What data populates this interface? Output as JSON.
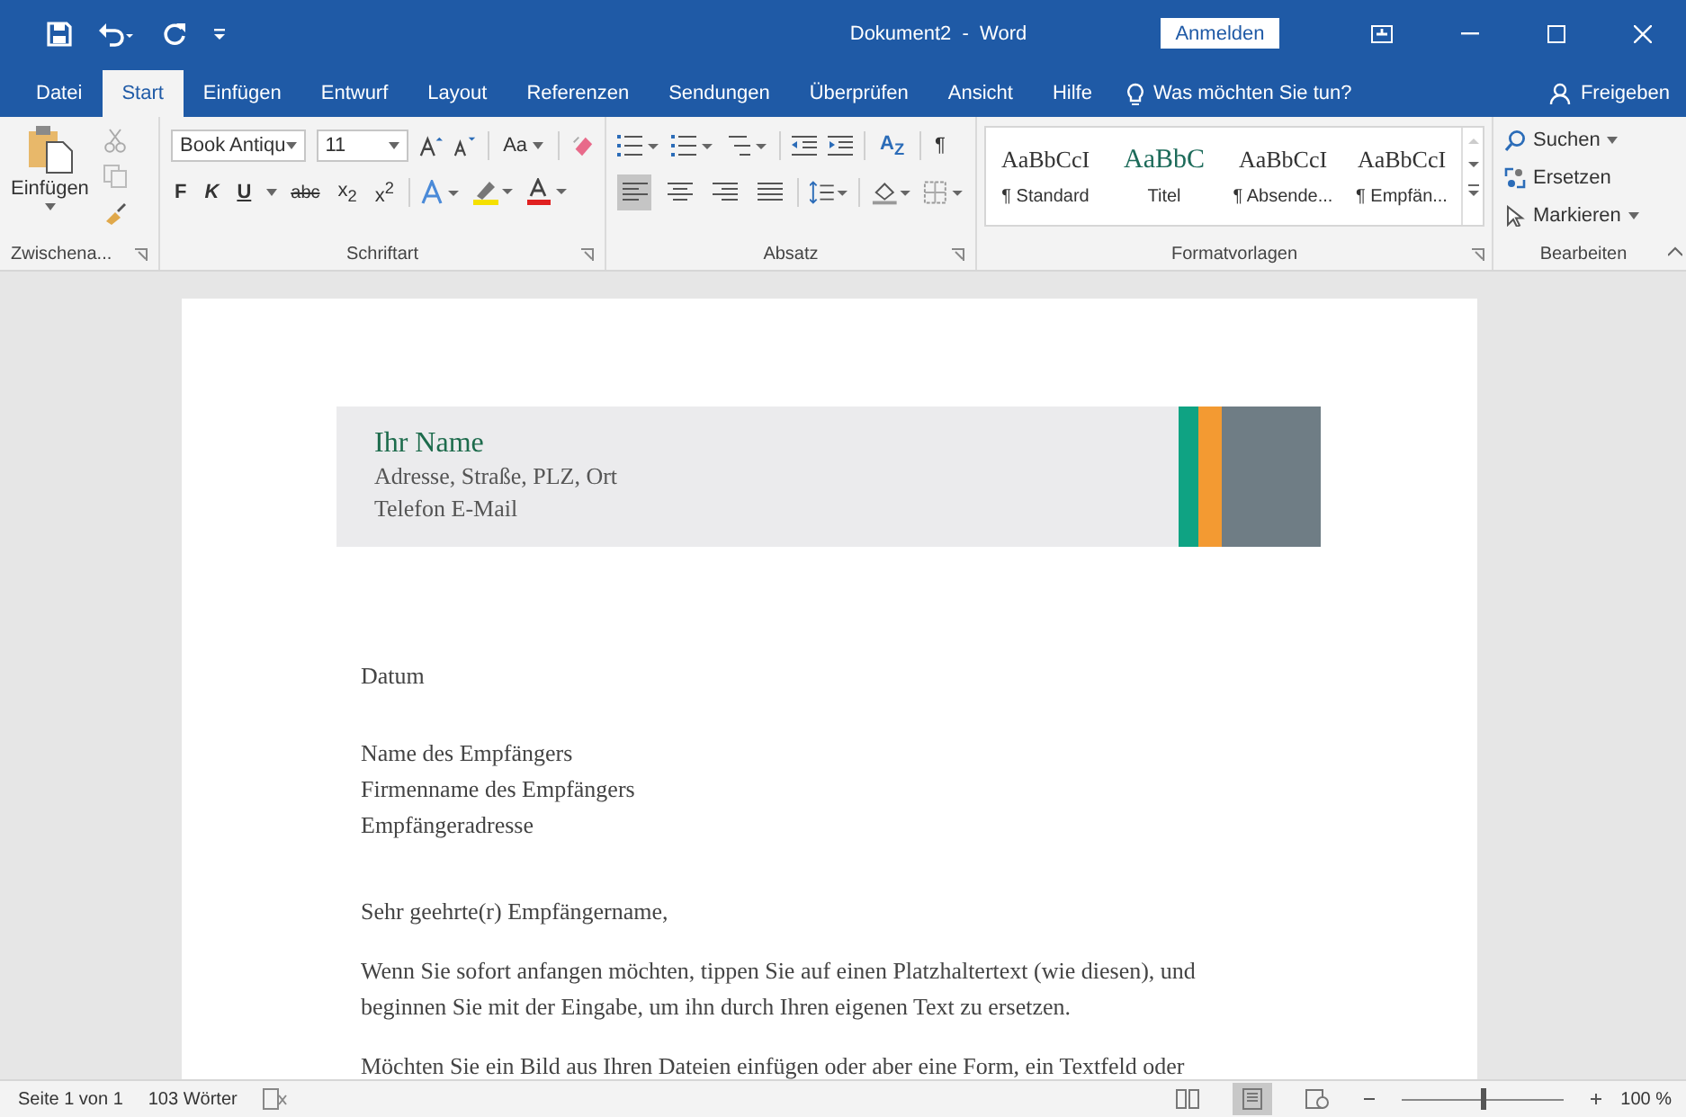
{
  "title_bar": {
    "title": "Dokument2  -  Word",
    "signin": "Anmelden"
  },
  "tabs": [
    {
      "label": "Datei",
      "selected": false
    },
    {
      "label": "Start",
      "selected": true
    },
    {
      "label": "Einfügen",
      "selected": false
    },
    {
      "label": "Entwurf",
      "selected": false
    },
    {
      "label": "Layout",
      "selected": false
    },
    {
      "label": "Referenzen",
      "selected": false
    },
    {
      "label": "Sendungen",
      "selected": false
    },
    {
      "label": "Überprüfen",
      "selected": false
    },
    {
      "label": "Ansicht",
      "selected": false
    },
    {
      "label": "Hilfe",
      "selected": false
    }
  ],
  "tell_me": "Was möchten Sie tun?",
  "share": "Freigeben",
  "clipboard": {
    "paste": "Einfügen",
    "label": "Zwischena..."
  },
  "font": {
    "name": "Book Antiqu",
    "size": "11",
    "change_case": "Aa",
    "bold": "F",
    "italic": "K",
    "underline": "U",
    "strike": "abc",
    "subscript": "x$_{2}$",
    "superscript": "x$^{2}$",
    "label": "Schriftart"
  },
  "paragraph": {
    "sort": "A$_{Z}$",
    "pilcrow": "¶",
    "label": "Absatz",
    "alignment": [
      {
        "kind": "left",
        "selected": true
      },
      {
        "kind": "center",
        "selected": false
      },
      {
        "kind": "right",
        "selected": false
      },
      {
        "kind": "justify",
        "selected": false
      }
    ]
  },
  "styles": {
    "label": "Formatvorlagen",
    "items": [
      {
        "kind": "normal",
        "sample": "AaBbCcI",
        "name": "¶ Standard"
      },
      {
        "kind": "title",
        "sample": "AaBbC",
        "name": "Titel"
      },
      {
        "kind": "normal",
        "sample": "AaBbCcI",
        "name": "¶ Absende..."
      },
      {
        "kind": "normal",
        "sample": "AaBbCcI",
        "name": "¶ Empfän..."
      }
    ]
  },
  "editing": {
    "label": "Bearbeiten",
    "find": "Suchen",
    "replace": "Ersetzen",
    "select": "Markieren"
  },
  "document": {
    "header": {
      "name": "Ihr Name",
      "address": "Adresse, Straße, PLZ, Ort",
      "contact": "Telefon  E-Mail"
    },
    "date": "Datum",
    "recipient": [
      "Name des Empfängers",
      "Firmenname des Empfängers",
      "Empfängeradresse"
    ],
    "salutation": "Sehr geehrte(r) Empfängername,",
    "paragraphs": [
      "Wenn Sie sofort anfangen möchten, tippen Sie auf einen Platzhaltertext (wie diesen), und beginnen Sie mit der Eingabe, um ihn durch Ihren eigenen Text zu ersetzen.",
      "Möchten Sie ein Bild aus Ihren Dateien einfügen oder aber eine Form, ein Textfeld oder"
    ]
  },
  "status_bar": {
    "page": "Seite 1 von 1",
    "words": "103 Wörter",
    "views": [
      {
        "kind": "read",
        "selected": false
      },
      {
        "kind": "print",
        "selected": true
      },
      {
        "kind": "web",
        "selected": false
      }
    ],
    "level": 0.5,
    "zoom": "100 %"
  }
}
